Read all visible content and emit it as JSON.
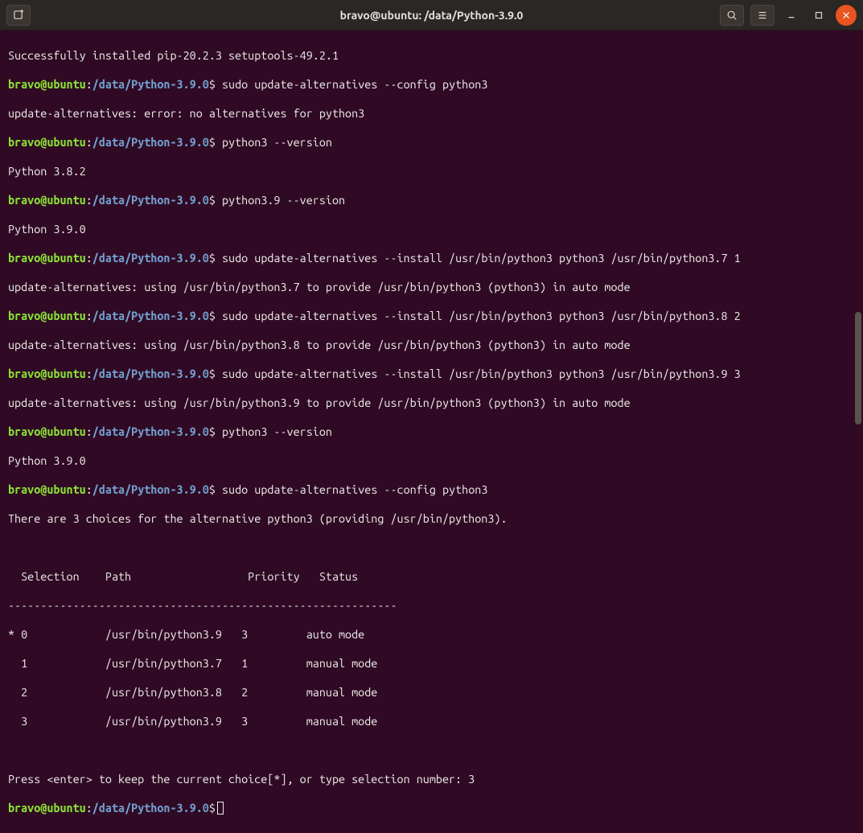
{
  "titlebar": {
    "title": "bravo@ubuntu: /data/Python-3.9.0"
  },
  "prompt": {
    "user_host": "bravo@ubuntu",
    "separator": ":",
    "path": "/data/Python-3.9.0",
    "symbol": "$"
  },
  "lines": {
    "l0": "Successfully installed pip-20.2.3 setuptools-49.2.1",
    "c1": " sudo update-alternatives --config python3",
    "l2": "update-alternatives: error: no alternatives for python3",
    "c3": " python3 --version",
    "l4": "Python 3.8.2",
    "c5": " python3.9 --version",
    "l6": "Python 3.9.0",
    "c7": " sudo update-alternatives --install /usr/bin/python3 python3 /usr/bin/python3.7 1",
    "l8": "update-alternatives: using /usr/bin/python3.7 to provide /usr/bin/python3 (python3) in auto mode",
    "c9": " sudo update-alternatives --install /usr/bin/python3 python3 /usr/bin/python3.8 2",
    "l10": "update-alternatives: using /usr/bin/python3.8 to provide /usr/bin/python3 (python3) in auto mode",
    "c11": " sudo update-alternatives --install /usr/bin/python3 python3 /usr/bin/python3.9 3",
    "l12": "update-alternatives: using /usr/bin/python3.9 to provide /usr/bin/python3 (python3) in auto mode",
    "c13": " python3 --version",
    "l14": "Python 3.9.0",
    "c15": " sudo update-alternatives --config python3",
    "l16": "There are 3 choices for the alternative python3 (providing /usr/bin/python3).",
    "blank": " ",
    "th": "  Selection    Path                  Priority   Status",
    "sep": "------------------------------------------------------------",
    "r0": "* 0            /usr/bin/python3.9   3         auto mode",
    "r1": "  1            /usr/bin/python3.7   1         manual mode",
    "r2": "  2            /usr/bin/python3.8   2         manual mode",
    "r3": "  3            /usr/bin/python3.9   3         manual mode",
    "prompt_line": "Press <enter> to keep the current choice[*], or type selection number: 3"
  },
  "table_data": {
    "headers": [
      "Selection",
      "Path",
      "Priority",
      "Status"
    ],
    "rows": [
      {
        "marker": "*",
        "selection": 0,
        "path": "/usr/bin/python3.9",
        "priority": 3,
        "status": "auto mode"
      },
      {
        "marker": " ",
        "selection": 1,
        "path": "/usr/bin/python3.7",
        "priority": 1,
        "status": "manual mode"
      },
      {
        "marker": " ",
        "selection": 2,
        "path": "/usr/bin/python3.8",
        "priority": 2,
        "status": "manual mode"
      },
      {
        "marker": " ",
        "selection": 3,
        "path": "/usr/bin/python3.9",
        "priority": 3,
        "status": "manual mode"
      }
    ],
    "user_input": "3"
  }
}
